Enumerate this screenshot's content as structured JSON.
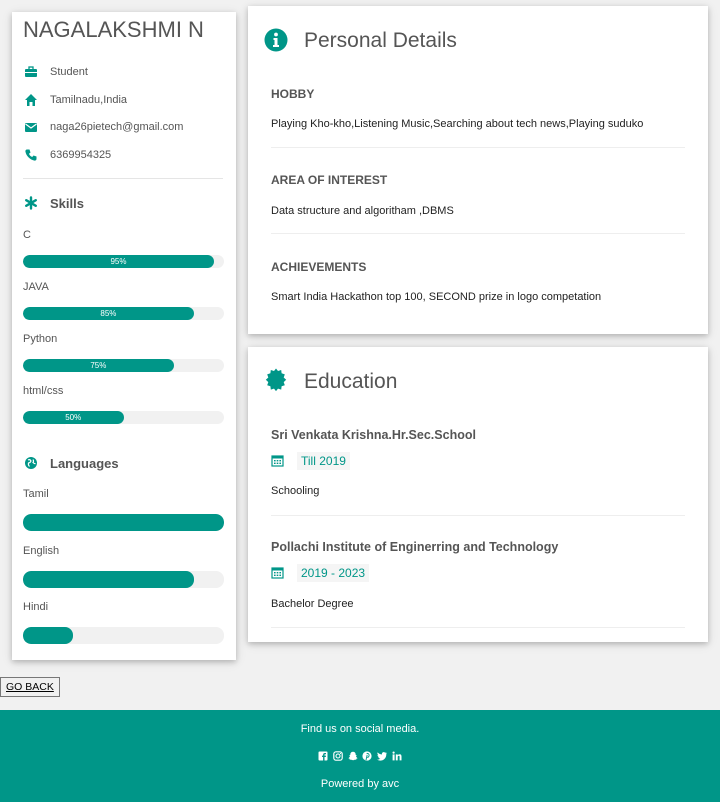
{
  "profile": {
    "name": "NAGALAKSHMI N",
    "info": [
      {
        "icon": "briefcase-icon",
        "text": "Student"
      },
      {
        "icon": "home-icon",
        "text": "Tamilnadu,India"
      },
      {
        "icon": "envelope-icon",
        "text": "naga26pietech@gmail.com"
      },
      {
        "icon": "phone-icon",
        "text": "6369954325"
      }
    ]
  },
  "skills": {
    "title": "Skills",
    "items": [
      {
        "label": "C",
        "percent_text": "95%",
        "level": 95
      },
      {
        "label": "JAVA",
        "percent_text": "85%",
        "level": 85
      },
      {
        "label": "Python",
        "percent_text": "75%",
        "level": 75
      },
      {
        "label": "html/css",
        "percent_text": "50%",
        "level": 50
      }
    ]
  },
  "languages": {
    "title": "Languages",
    "items": [
      {
        "label": "Tamil",
        "level": 100
      },
      {
        "label": "English",
        "level": 85
      },
      {
        "label": "Hindi",
        "level": 25
      }
    ]
  },
  "personal": {
    "title": "Personal Details",
    "sections": [
      {
        "heading": "HOBBY",
        "text": "Playing Kho-kho,Listening Music,Searching about tech news,Playing suduko"
      },
      {
        "heading": "AREA OF INTEREST",
        "text": "Data structure and algoritham ,DBMS"
      },
      {
        "heading": "ACHIEVEMENTS",
        "text": "Smart India Hackathon top 100, SECOND prize in logo competation"
      }
    ]
  },
  "education": {
    "title": "Education",
    "items": [
      {
        "school": "Sri Venkata Krishna.Hr.Sec.School",
        "period": "Till 2019",
        "degree": "Schooling"
      },
      {
        "school": "Pollachi Institute of Enginerring and Technology",
        "period": "2019 - 2023",
        "degree": "Bachelor Degree"
      }
    ]
  },
  "go_back": "GO BACK",
  "footer": {
    "find_us": "Find us on social media.",
    "social_icons": [
      "facebook-icon",
      "instagram-icon",
      "snapchat-icon",
      "pinterest-icon",
      "twitter-icon",
      "linkedin-icon"
    ],
    "powered_by": "Powered by avc"
  },
  "colors": {
    "accent": "#009688",
    "bar_track": "#f1f1f1"
  }
}
